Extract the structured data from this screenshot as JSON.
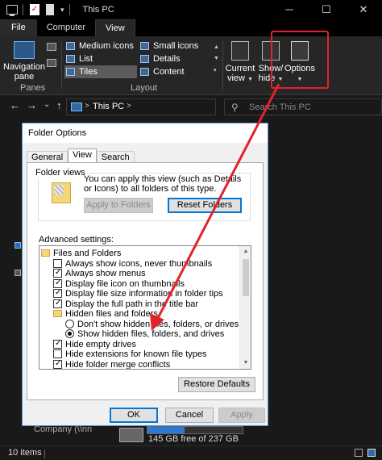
{
  "titlebar": {
    "title": "This PC",
    "caret": "▾",
    "check": "✓",
    "buttons": {
      "minimize": "─",
      "maximize": "☐",
      "close": "✕"
    }
  },
  "tabs": [
    "File",
    "Computer",
    "View"
  ],
  "ribbon": {
    "nav_pane_line1": "Navigation",
    "nav_pane_line2": "pane",
    "panes_label": "Panes",
    "layout_label": "Layout",
    "layout_items": [
      "Medium icons",
      "Small icons",
      "List",
      "Details",
      "Tiles",
      "Content"
    ],
    "selected_layout": "Tiles",
    "current_view_line1": "Current",
    "current_view_line2": "view",
    "show_hide_line1": "Show/",
    "show_hide_line2": "hide",
    "options_label": "Options",
    "caret": "▼"
  },
  "address": {
    "back": "←",
    "forward": "→",
    "recent": "⌄",
    "up": "↑",
    "path": "This PC",
    "sep": ">",
    "search_placeholder": "Search This PC",
    "search_icon": "⚲"
  },
  "explorer": {
    "company_text": "Company (\\\\nn",
    "drive_free": "145 GB free of 237 GB",
    "drive_used_fraction": 0.39
  },
  "statusbar": {
    "items": "10 items"
  },
  "dialog": {
    "title": "Folder Options",
    "tabs": [
      "General",
      "View",
      "Search"
    ],
    "active_tab": "View",
    "folder_views_legend": "Folder views",
    "folder_views_text": "You can apply this view (such as Details or Icons) to all folders of this type.",
    "apply_button": "Apply to Folders",
    "reset_button": "Reset Folders",
    "advanced_label": "Advanced settings:",
    "tree": [
      {
        "kind": "folder",
        "indent": 0,
        "label": "Files and Folders"
      },
      {
        "kind": "check",
        "checked": false,
        "indent": 1,
        "label": "Always show icons, never thumbnails"
      },
      {
        "kind": "check",
        "checked": true,
        "indent": 1,
        "label": "Always show menus"
      },
      {
        "kind": "check",
        "checked": true,
        "indent": 1,
        "label": "Display file icon on thumbnails"
      },
      {
        "kind": "check",
        "checked": true,
        "indent": 1,
        "label": "Display file size information in folder tips"
      },
      {
        "kind": "check",
        "checked": true,
        "indent": 1,
        "label": "Display the full path in the title bar"
      },
      {
        "kind": "folder",
        "indent": 1,
        "label": "Hidden files and folders"
      },
      {
        "kind": "radio",
        "checked": false,
        "indent": 2,
        "label": "Don't show hidden files, folders, or drives"
      },
      {
        "kind": "radio",
        "checked": true,
        "indent": 2,
        "label": "Show hidden files, folders, and drives"
      },
      {
        "kind": "check",
        "checked": true,
        "indent": 1,
        "label": "Hide empty drives"
      },
      {
        "kind": "check",
        "checked": false,
        "indent": 1,
        "label": "Hide extensions for known file types"
      },
      {
        "kind": "check",
        "checked": true,
        "indent": 1,
        "label": "Hide folder merge conflicts"
      }
    ],
    "restore_button": "Restore Defaults",
    "ok_button": "OK",
    "cancel_button": "Cancel",
    "apply_bottom_button": "Apply"
  },
  "colors": {
    "annotation_red": "#e0242a",
    "accent_blue": "#0078d7"
  }
}
